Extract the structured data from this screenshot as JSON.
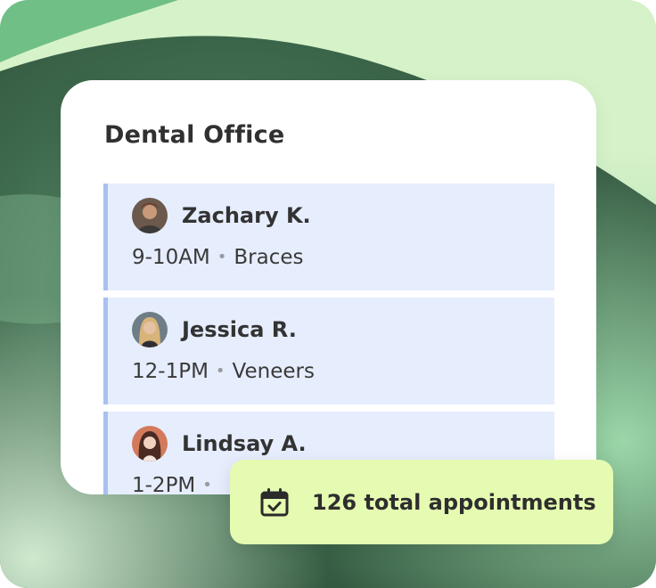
{
  "card": {
    "title": "Dental Office"
  },
  "appointments": [
    {
      "name": "Zachary K.",
      "time": "9-10AM",
      "service": "Braces",
      "avatar": "avatar-zachary"
    },
    {
      "name": "Jessica R.",
      "time": "12-1PM",
      "service": "Veneers",
      "avatar": "avatar-jessica"
    },
    {
      "name": "Lindsay A.",
      "time": "1-2PM",
      "service": "",
      "avatar": "avatar-lindsay"
    }
  ],
  "separator": "•",
  "summary": {
    "text": "126 total appointments",
    "icon": "calendar-check-icon"
  },
  "colors": {
    "appointment_bg": "#e6edfd",
    "appointment_accent": "#a9c0f0",
    "summary_bg": "#e5fbb1",
    "background_dark": "#2f5a3f",
    "background_light": "#d6f2c9"
  }
}
